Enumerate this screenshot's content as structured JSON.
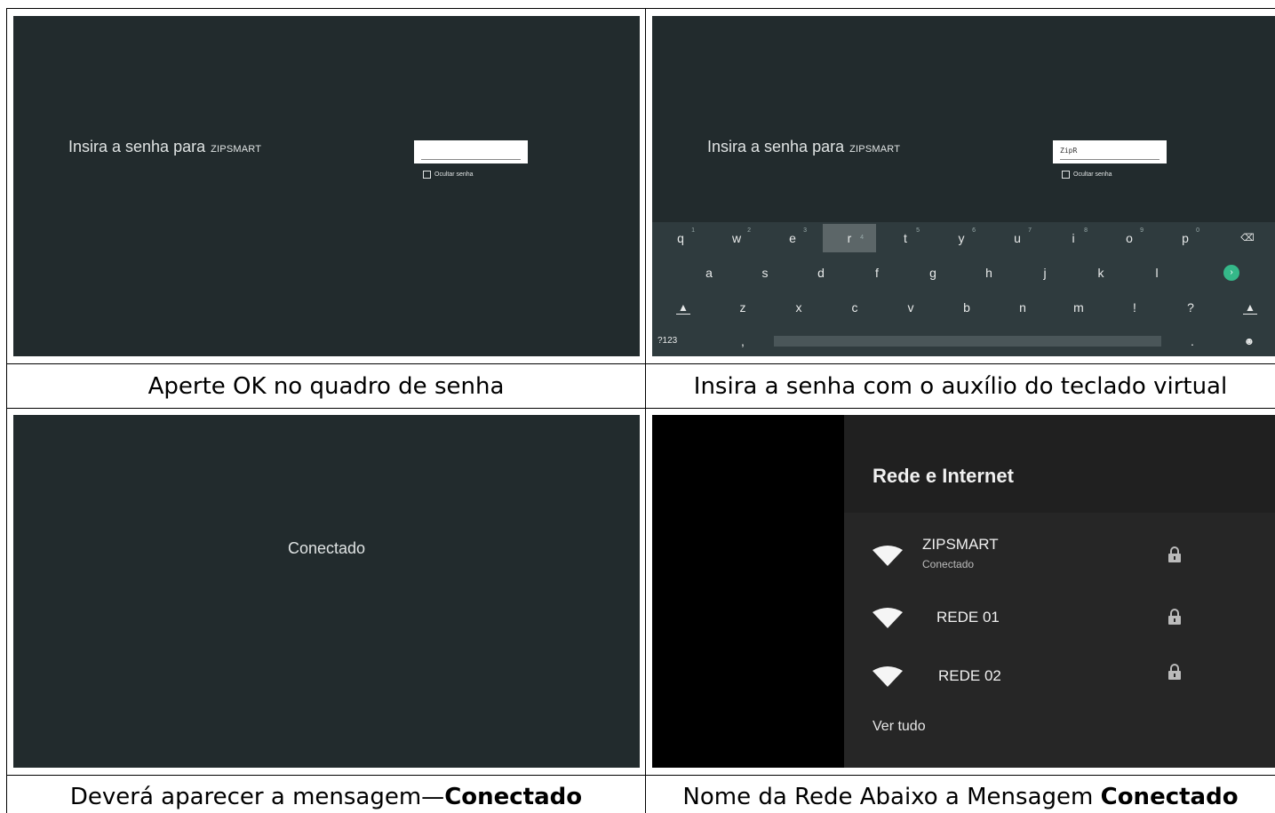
{
  "panel1": {
    "prompt": "Insira a senha para",
    "ssid": "ZIPSMART",
    "checkbox_label": "Ocultar senha"
  },
  "panel2": {
    "prompt": "Insira a senha para",
    "ssid": "ZIPSMART",
    "password_value": "ZipR",
    "checkbox_label": "Ocultar senha",
    "keyboard": {
      "row1": [
        {
          "k": "q",
          "n": "1"
        },
        {
          "k": "w",
          "n": "2"
        },
        {
          "k": "e",
          "n": "3"
        },
        {
          "k": "r",
          "n": "4"
        },
        {
          "k": "t",
          "n": "5"
        },
        {
          "k": "y",
          "n": "6"
        },
        {
          "k": "u",
          "n": "7"
        },
        {
          "k": "i",
          "n": "8"
        },
        {
          "k": "o",
          "n": "9"
        },
        {
          "k": "p",
          "n": "0"
        }
      ],
      "row2": [
        "a",
        "s",
        "d",
        "f",
        "g",
        "h",
        "j",
        "k",
        "l"
      ],
      "row3": [
        "z",
        "x",
        "c",
        "v",
        "b",
        "n",
        "m",
        "!",
        "?"
      ],
      "symbols_key": "?123",
      "comma_key": ",",
      "period_key": ".",
      "highlighted_key": "r"
    }
  },
  "panel3": {
    "status": "Conectado"
  },
  "panel4": {
    "title": "Rede e Internet",
    "networks": [
      {
        "name": "ZIPSMART",
        "status": "Conectado"
      },
      {
        "name": "REDE 01",
        "status": ""
      },
      {
        "name": "REDE 02",
        "status": ""
      }
    ],
    "see_all": "Ver tudo"
  },
  "captions": {
    "c1": "Aperte OK no quadro de senha",
    "c2": "Insira a senha com o auxílio do teclado virtual",
    "c3_prefix": "Deverá aparecer a mensagem—",
    "c3_bold": "Conectado",
    "c4_prefix": "Nome da Rede Abaixo a Mensagem ",
    "c4_bold": "Conectado"
  },
  "colors": {
    "screen_bg": "#222b2d",
    "keyboard_bg": "#2f3b3e",
    "accent_go": "#35b889"
  }
}
